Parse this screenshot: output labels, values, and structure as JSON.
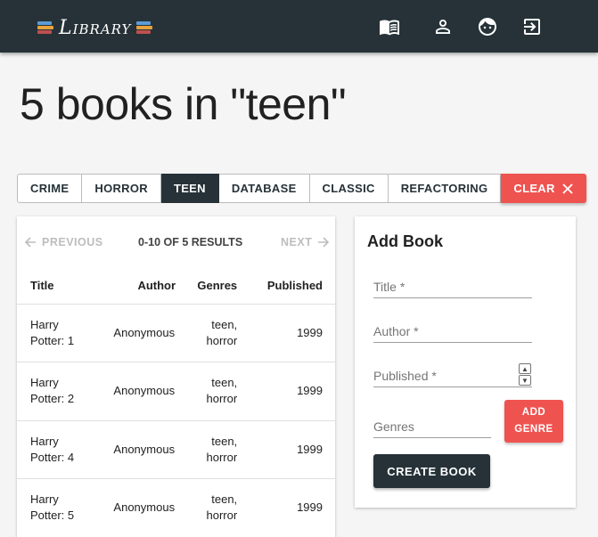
{
  "app": {
    "name": "Library"
  },
  "nav": {
    "icons": [
      "book-open-icon",
      "user-icon",
      "face-icon",
      "logout-icon"
    ]
  },
  "page": {
    "title": "5 books in \"teen\""
  },
  "genre_filters": {
    "items": [
      "CRIME",
      "HORROR",
      "TEEN",
      "DATABASE",
      "CLASSIC",
      "REFACTORING"
    ],
    "active": "TEEN",
    "clear_label": "CLEAR"
  },
  "pager": {
    "previous": "PREVIOUS",
    "info": "0-10 OF 5 RESULTS",
    "next": "NEXT"
  },
  "table": {
    "columns": [
      "Title",
      "Author",
      "Genres",
      "Published"
    ],
    "rows": [
      {
        "title": [
          "Harry",
          "Potter: 1"
        ],
        "author": "Anonymous",
        "genres": [
          "teen,",
          "horror"
        ],
        "published": "1999"
      },
      {
        "title": [
          "Harry",
          "Potter: 2"
        ],
        "author": "Anonymous",
        "genres": [
          "teen,",
          "horror"
        ],
        "published": "1999"
      },
      {
        "title": [
          "Harry",
          "Potter: 4"
        ],
        "author": "Anonymous",
        "genres": [
          "teen,",
          "horror"
        ],
        "published": "1999"
      },
      {
        "title": [
          "Harry",
          "Potter: 5"
        ],
        "author": "Anonymous",
        "genres": [
          "teen,",
          "horror"
        ],
        "published": "1999"
      }
    ]
  },
  "form": {
    "title": "Add Book",
    "title_placeholder": "Title *",
    "author_placeholder": "Author *",
    "published_placeholder": "Published *",
    "genres_placeholder": "Genres",
    "add_genre_lines": [
      "ADD",
      "GENRE"
    ],
    "create_label": "CREATE BOOK"
  },
  "colors": {
    "dark": "#263238",
    "accent": "#ef5350",
    "background": "#f5f5f5"
  }
}
